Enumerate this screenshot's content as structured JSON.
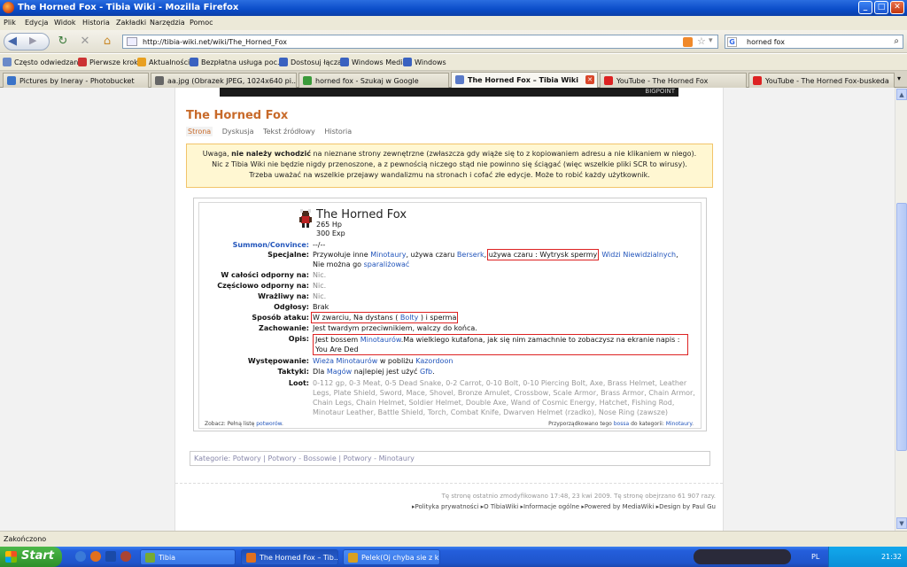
{
  "window": {
    "title": "The Horned Fox - Tibia Wiki - Mozilla Firefox"
  },
  "menu": [
    "Plik",
    "Edycja",
    "Widok",
    "Historia",
    "Zakładki",
    "Narzędzia",
    "Pomoc"
  ],
  "address": {
    "url": "http://tibia-wiki.net/wiki/The_Horned_Fox"
  },
  "search": {
    "value": "horned fox"
  },
  "bookmarks": [
    "Często odwiedzane",
    "Pierwsze kroki",
    "Aktualności",
    "Bezpłatna usługa poc...",
    "Dostosuj łącza",
    "Windows Media",
    "Windows"
  ],
  "tabs": [
    "Pictures by Ineray - Photobucket",
    "aa.jpg (Obrazek JPEG, 1024x640 pi...",
    "horned fox - Szukaj w Google",
    "The Horned Fox – Tibia Wiki",
    "YouTube - The Horned Fox",
    "YouTube - The Horned Fox-buskeda"
  ],
  "banner": {
    "text": "BIGPOINT"
  },
  "page": {
    "title": "The Horned Fox",
    "subtabs": [
      "Strona",
      "Dyskusja",
      "Tekst źródłowy",
      "Historia"
    ],
    "warning": {
      "line1_pre": "Uwaga, ",
      "line1_bold": "nie należy wchodzić",
      "line1_post": " na nieznane strony zewnętrzne (zwłaszcza gdy wiąże się to z kopiowaniem adresu a nie klikaniem w niego).",
      "line2": "Nic z Tibia Wiki nie będzie nigdy przenoszone, a z pewnością niczego stąd nie powinno się ściągać (więc wszelkie pliki SCR to wirusy).",
      "line3": "Trzeba uważać na wszelkie przejawy wandalizmu na stronach i cofać złe edycje. Może to robić każdy użytkownik."
    },
    "creature": {
      "name": "The Horned Fox",
      "hp": "265 Hp",
      "exp": "300 Exp",
      "summon_label": "Summon/Convince:",
      "summon_value": "--/--",
      "special_label": "Specjalne:",
      "special_1": "Przywołuje inne ",
      "special_minotaury": "Minotaury",
      "special_2": ", używa czaru ",
      "special_berserk": "Berserk",
      "special_3": ", ",
      "special_boxed": "używa czaru : Wytrysk spermy",
      "special_4": ", ",
      "special_widzi": "Widzi Niewidzialnych",
      "special_5": ",",
      "special_6": "Nie można go ",
      "special_spar": "sparaliżować",
      "full_resist_label": "W całości odporny na:",
      "full_resist_value": "Nic.",
      "part_resist_label": "Częściowo odporny na:",
      "part_resist_value": "Nic.",
      "weak_label": "Wrażliwy na:",
      "weak_value": "Nic.",
      "sounds_label": "Odgłosy:",
      "sounds_value": "Brak",
      "attack_label": "Sposób ataku:",
      "attack_1": "W zwarciu, Na dystans ( ",
      "attack_bolty": "Bolty",
      "attack_2": " ) i sperma",
      "behav_label": "Zachowanie:",
      "behav_value": "Jest twardym przeciwnikiem, walczy do końca.",
      "desc_label": "Opis:",
      "desc_1": "Jest bossem ",
      "desc_link": "Minotaurów",
      "desc_2": ".Ma wielkiego kutafona, jak się nim zamachnie to zobaczysz na ekranie napis : You Are Ded",
      "loc_label": "Występowanie:",
      "loc_1": "Wieża Minotaurów",
      "loc_2": " w pobliżu ",
      "loc_3": "Kazordoon",
      "tactics_label": "Taktyki:",
      "tactics_1": "Dla ",
      "tactics_2": "Magów",
      "tactics_3": " najlepiej jest użyć ",
      "tactics_4": "Gfb",
      "tactics_5": ".",
      "loot_label": "Loot:",
      "loot_value": "0-112 gp, 0-3 Meat, 0-5 Dead Snake, 0-2 Carrot, 0-10 Bolt, 0-10 Piercing Bolt, Axe, Brass Helmet, Leather Legs, Plate Shield, Sword, Mace, Shovel, Bronze Amulet, Crossbow, Scale Armor, Brass Armor, Chain Armor, Chain Legs, Chain Helmet, Soldier Helmet, Double Axe, Wand of Cosmic Energy, Hatchet, Fishing Rod, Minotaur Leather, Battle Shield, Torch, Combat Knife, Dwarven Helmet (rzadko), Nose Ring (zawsze)",
      "see_1": "Zobacz: Pełną listę ",
      "see_link": "potworów",
      "see_2": ".",
      "assign_1": "Przyporządkowano tego ",
      "assign_boss": "bossa",
      "assign_2": " do kategorii: ",
      "assign_cat": "Minotaury",
      "assign_3": "."
    },
    "categories": "Kategorie: Potwory | Potwory - Bossowie | Potwory - Minotaury",
    "lastmod": "Tę stronę ostatnio zmodyfikowano 17:48, 23 kwi 2009. Tę stronę obejrzano 61 907 razy.",
    "footer_links": "▸Polityka prywatności  ▸O TibiaWiki  ▸Informacje ogólne  ▸Powered by MediaWiki  ▸Design by Paul Gu"
  },
  "status": {
    "text": "Zakończono"
  },
  "taskbar": {
    "start": "Start",
    "items": [
      "Tibia",
      "The Horned Fox – Tib...",
      "Pelek(Oj chyba sie z k..."
    ],
    "lang": "PL",
    "time": "21:32"
  }
}
